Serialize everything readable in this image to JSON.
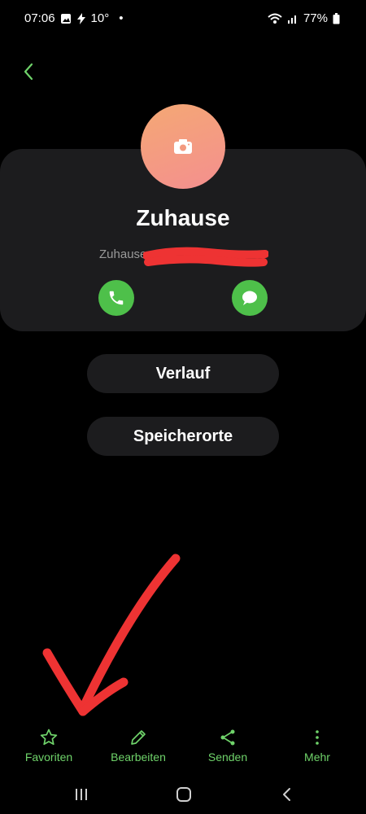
{
  "status_bar": {
    "time": "07:06",
    "temperature": "10°",
    "battery": "77%",
    "icons": [
      "image-icon",
      "flash-icon",
      "dot-icon",
      "wifi-icon",
      "signal-icon",
      "battery-icon"
    ]
  },
  "contact": {
    "name": "Zuhause",
    "number_visible": "Zuhause"
  },
  "buttons": {
    "history": "Verlauf",
    "locations": "Speicherorte"
  },
  "bottom_actions": [
    {
      "label": "Favoriten",
      "icon": "star-icon"
    },
    {
      "label": "Bearbeiten",
      "icon": "pencil-icon"
    },
    {
      "label": "Senden",
      "icon": "share-icon"
    },
    {
      "label": "Mehr",
      "icon": "more-vertical-icon"
    }
  ],
  "colors": {
    "accent": "#6fd36a",
    "action_green": "#4ec04a",
    "card_bg": "#1c1c1e",
    "annotation_red": "#ee3333"
  }
}
